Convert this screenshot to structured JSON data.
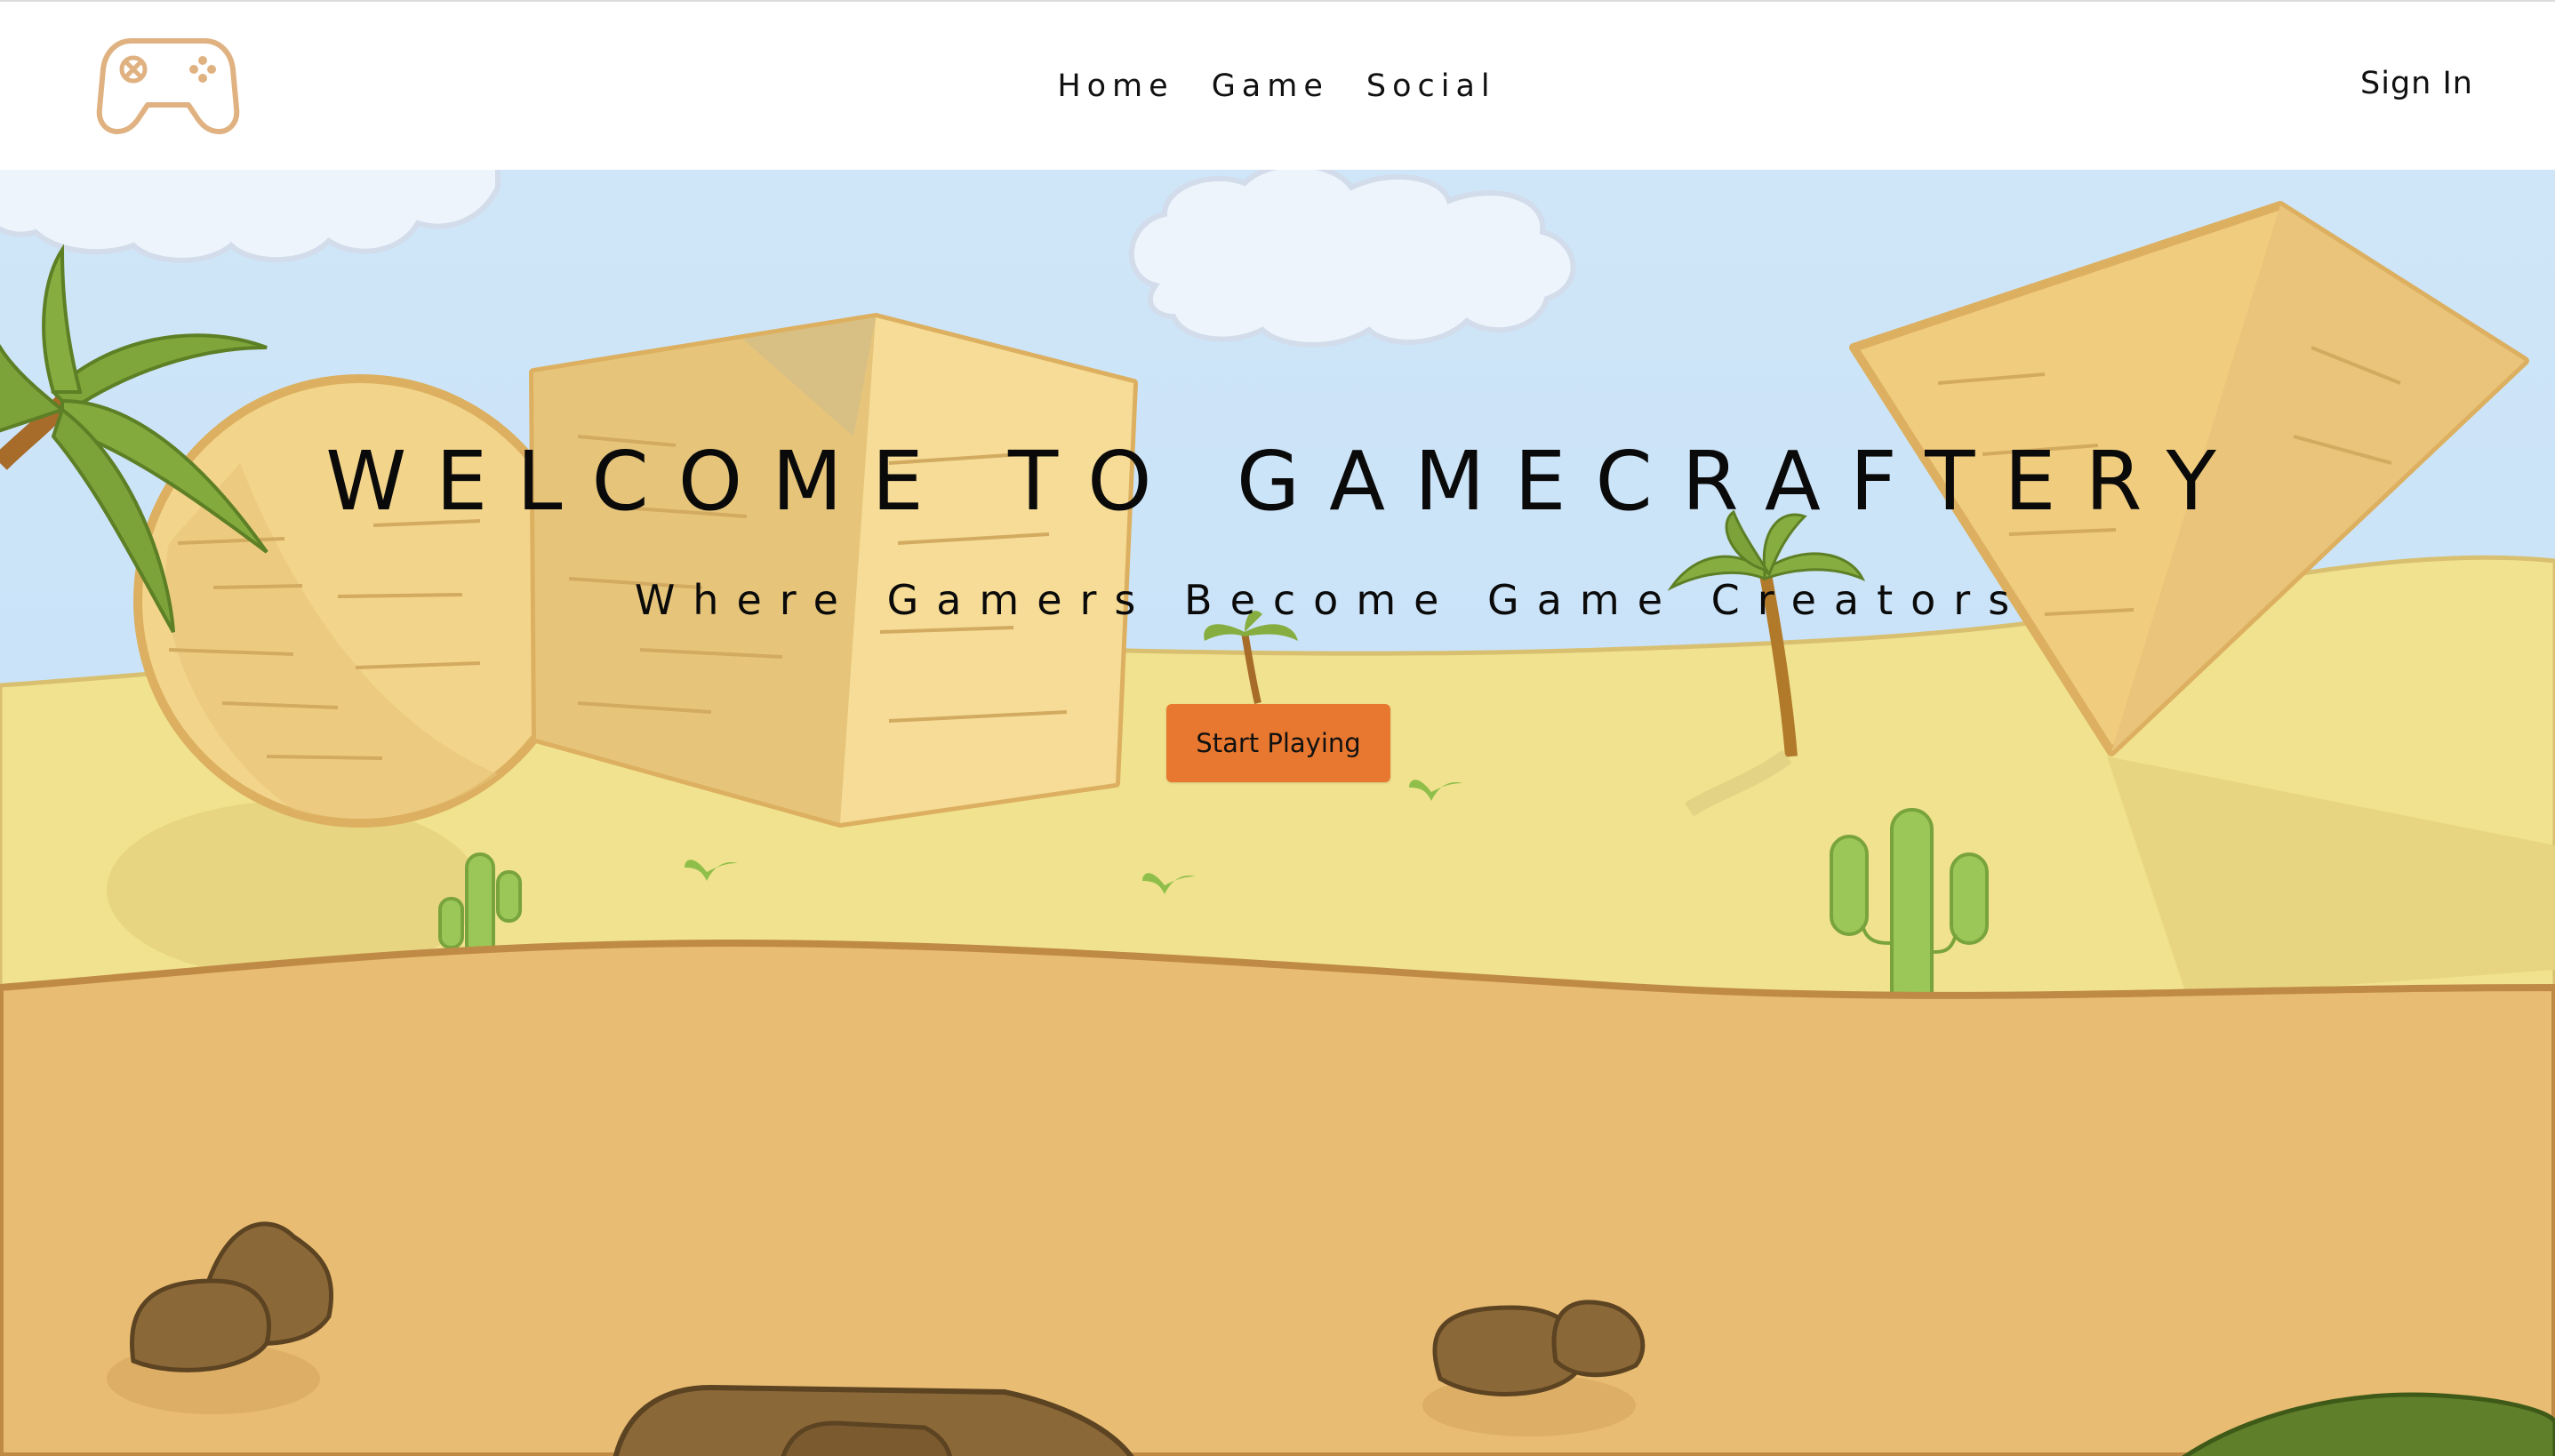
{
  "navbar": {
    "logo_icon": "gamepad-icon",
    "links": [
      {
        "label": "Home"
      },
      {
        "label": "Game"
      },
      {
        "label": "Social"
      }
    ],
    "signin_label": "Sign In"
  },
  "hero": {
    "title": "WELCOME TO GAMECRAFTERY",
    "subtitle": "Where Gamers Become Game Creators",
    "cta_label": "Start Playing"
  },
  "colors": {
    "accent": "#e8782f",
    "logo": "#e0b281",
    "sky": "#cfe6f8",
    "sand": "#f0e090",
    "ground": "#e8bc72"
  }
}
